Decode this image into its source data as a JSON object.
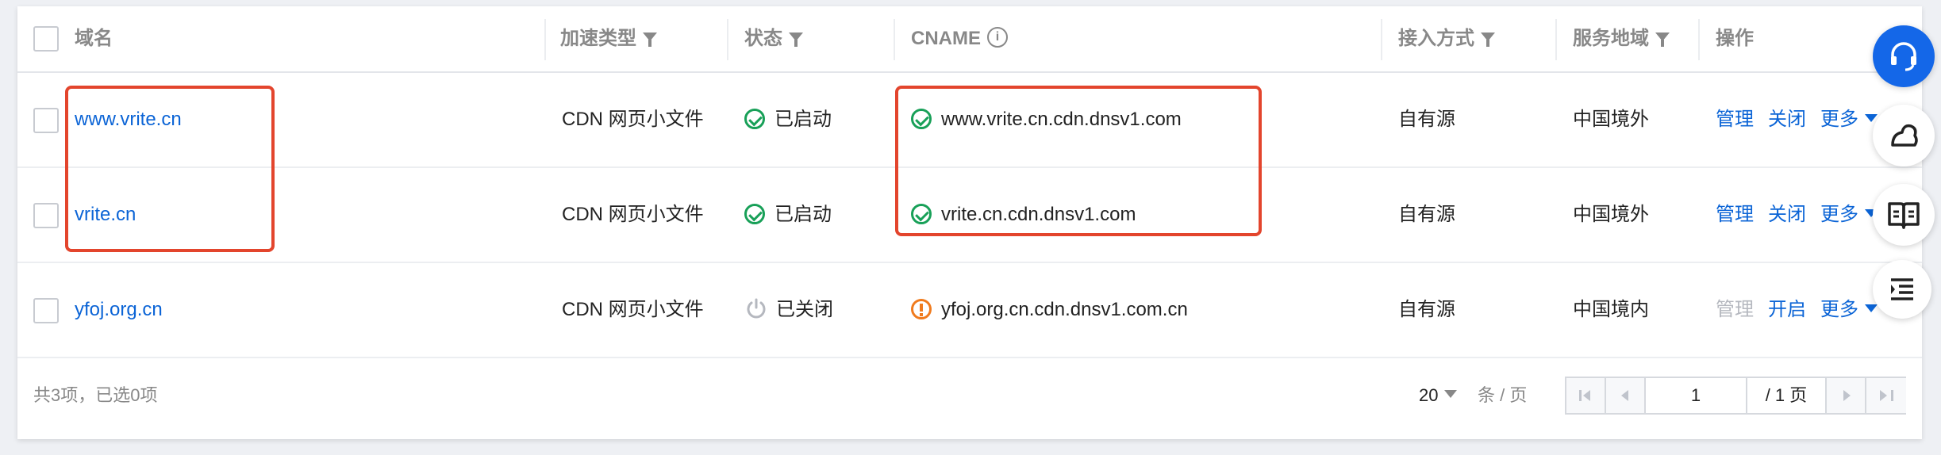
{
  "columns": {
    "domain": "域名",
    "accel_type": "加速类型",
    "status": "状态",
    "cname": "CNAME",
    "access": "接入方式",
    "region": "服务地域",
    "actions": "操作"
  },
  "rows": [
    {
      "domain": "www.vrite.cn",
      "accel_type": "CDN 网页小文件",
      "status": "已启动",
      "status_icon": "check-circle-icon",
      "cname": "www.vrite.cn.cdn.dnsv1.com",
      "cname_icon": "check-circle-icon",
      "access": "自有源",
      "region": "中国境外",
      "action_manage": "管理",
      "action_toggle": "关闭",
      "action_more": "更多"
    },
    {
      "domain": "vrite.cn",
      "accel_type": "CDN 网页小文件",
      "status": "已启动",
      "status_icon": "check-circle-icon",
      "cname": "vrite.cn.cdn.dnsv1.com",
      "cname_icon": "check-circle-icon",
      "access": "自有源",
      "region": "中国境外",
      "action_manage": "管理",
      "action_toggle": "关闭",
      "action_more": "更多"
    },
    {
      "domain": "yfoj.org.cn",
      "accel_type": "CDN 网页小文件",
      "status": "已关闭",
      "status_icon": "power-icon",
      "cname": "yfoj.org.cn.cdn.dnsv1.com.cn",
      "cname_icon": "warning-circle-icon",
      "access": "自有源",
      "region": "中国境内",
      "action_manage": "管理",
      "action_toggle": "开启",
      "action_more": "更多"
    }
  ],
  "footer": {
    "summary": "共3项，已选0项",
    "page_size": "20",
    "page_size_unit": "条 / 页",
    "current_page": "1",
    "total_pages": "/ 1 页"
  },
  "colors": {
    "link": "#0b64d6",
    "success": "#18a058",
    "warning": "#f07b1e",
    "highlight": "#e3452d",
    "primary": "#1467e8"
  }
}
